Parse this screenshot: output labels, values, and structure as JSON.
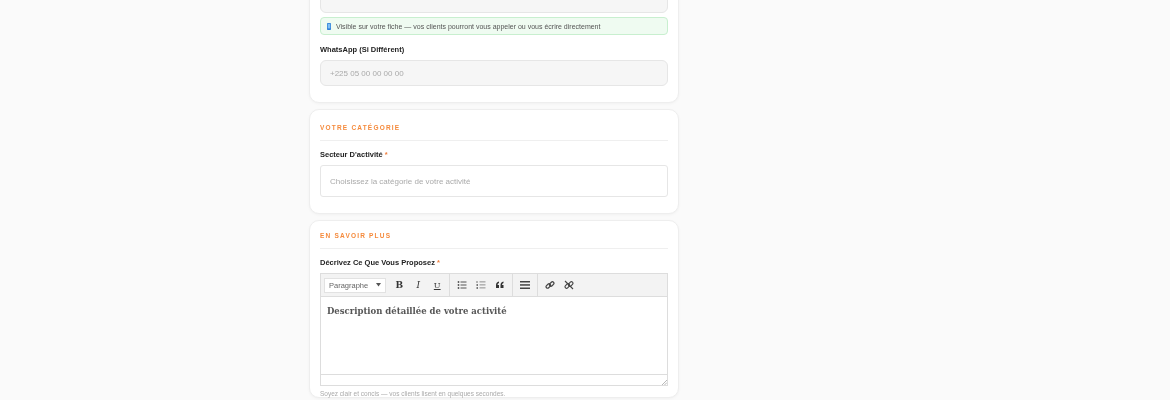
{
  "contact_card": {
    "visibility_notice": "Visible sur votre fiche — vos clients pourront vous appeler ou vous écrire directement",
    "whatsapp": {
      "label": "WhatsApp (Si Différent)",
      "placeholder": "+225 05 00 00 00 00"
    }
  },
  "category_card": {
    "heading": "VOTRE CATÉGORIE",
    "field": {
      "label": "Secteur D'activité",
      "required_mark": "*",
      "placeholder": "Choisissez la catégorie de votre activité"
    }
  },
  "about_card": {
    "heading": "EN SAVOIR PLUS",
    "label": "Décrivez Ce Que Vous Proposez",
    "required_mark": "*",
    "toolbar": [
      {
        "kind": "dropdown",
        "label": "Paragraphe"
      },
      {
        "kind": "bold",
        "label": "B"
      },
      {
        "kind": "italic",
        "label": "I"
      },
      {
        "kind": "underline",
        "label": "U"
      },
      {
        "kind": "separator"
      },
      {
        "kind": "bullet-list"
      },
      {
        "kind": "numbered-list"
      },
      {
        "kind": "quote"
      },
      {
        "kind": "separator"
      },
      {
        "kind": "horizontal-rule"
      },
      {
        "kind": "separator"
      },
      {
        "kind": "link"
      },
      {
        "kind": "unlink"
      }
    ],
    "editor_value": "Description détaillée de votre activité",
    "hint": "Soyez clair et concis — vos clients lisent en quelques secondes."
  }
}
